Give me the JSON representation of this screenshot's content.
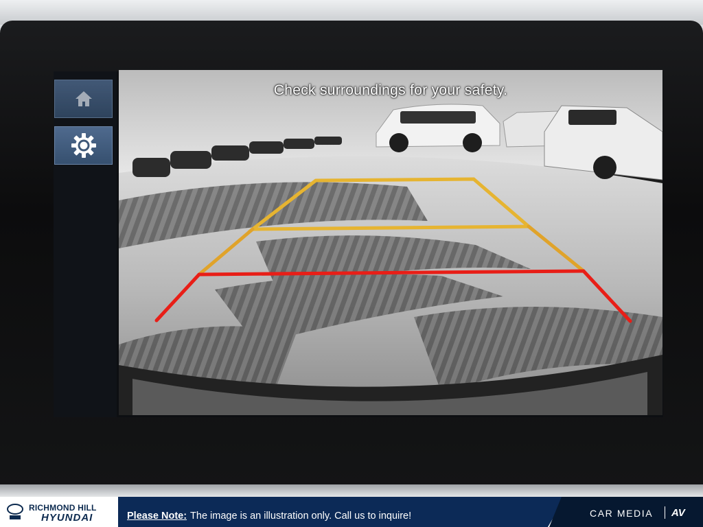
{
  "camera_view": {
    "safety_message": "Check surroundings for your safety.",
    "guide_colors": {
      "far": "#e6b431",
      "middle": "#e0a32a",
      "near": "#e81e17"
    }
  },
  "sidebar": {
    "buttons": [
      {
        "icon": "home-icon"
      },
      {
        "icon": "gear-icon"
      }
    ]
  },
  "footer": {
    "dealer_name": "RICHMOND HILL",
    "brand_name": "HYUNDAI",
    "note_label": "Please Note:",
    "note_body": "The image is an illustration only. Call us to inquire!",
    "media_name": "CAR MEDIA",
    "media_logo": "AV",
    "accent_color": "#0c2a57"
  }
}
